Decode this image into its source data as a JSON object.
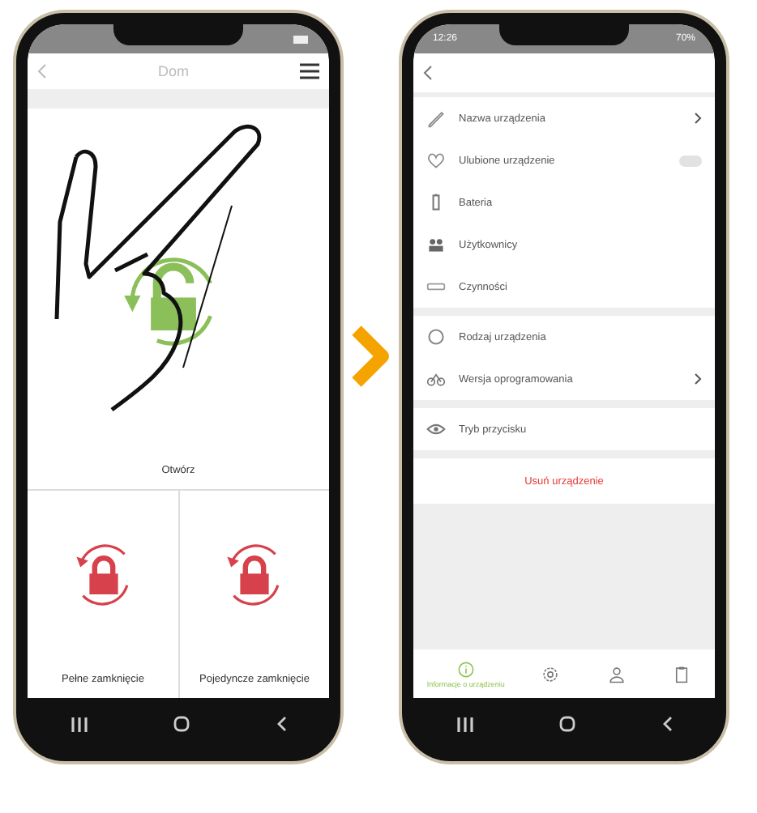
{
  "left_phone": {
    "header": {
      "title": "Dom"
    },
    "main_action": {
      "label": "Otwórz"
    },
    "actions": [
      {
        "label": "Pełne zamknięcie"
      },
      {
        "label": "Pojedyncze zamknięcie"
      }
    ]
  },
  "right_phone": {
    "status_bar": {
      "time": "12:26",
      "battery": "70%"
    },
    "groups": [
      [
        {
          "kind": "link",
          "label": "Nazwa urządzenia"
        },
        {
          "kind": "toggle",
          "label": "Ulubione urządzenie",
          "on": false
        },
        {
          "kind": "plain",
          "label": "Bateria"
        },
        {
          "kind": "plain",
          "label": "Użytkownicy"
        },
        {
          "kind": "plain",
          "label": "Czynności"
        }
      ],
      [
        {
          "kind": "plain",
          "label": "Rodzaj urządzenia"
        },
        {
          "kind": "link",
          "label": "Wersja oprogramowania"
        }
      ],
      [
        {
          "kind": "plain",
          "label": "Tryb przycisku"
        }
      ]
    ],
    "delete_label": "Usuń urządzenie",
    "tabs": [
      {
        "label": "Informacje o urządzeniu",
        "selected": true
      },
      {
        "selected": false
      },
      {
        "selected": false
      },
      {
        "selected": false
      }
    ]
  }
}
